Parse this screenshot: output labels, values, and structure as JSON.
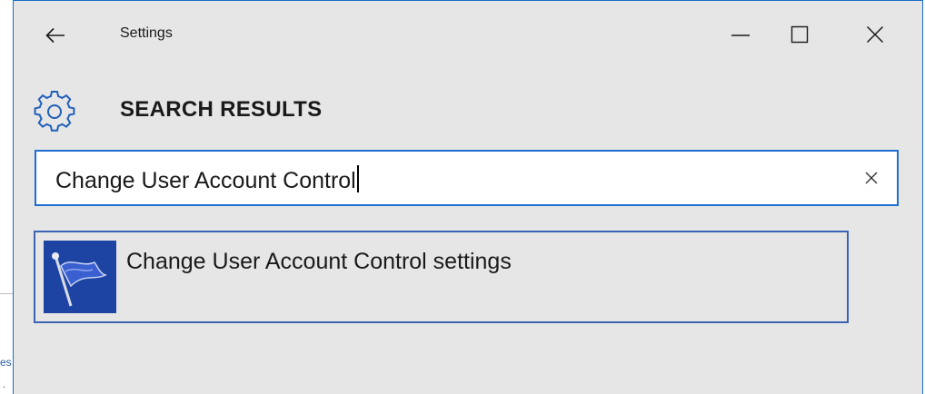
{
  "window": {
    "title": "Settings",
    "controls": {
      "minimize": "minimize-icon",
      "maximize": "maximize-icon",
      "close": "close-icon"
    },
    "back": "back-arrow-icon"
  },
  "header": {
    "title": "SEARCH RESULTS",
    "icon": "gear-icon"
  },
  "search": {
    "value": "Change User Account Control",
    "clear_icon": "clear-icon"
  },
  "results": [
    {
      "label": "Change User Account Control settings",
      "icon": "uac-flag-icon"
    }
  ],
  "background_window": {
    "link_fragment": "es",
    "text_fragment": "."
  },
  "colors": {
    "window_bg": "#e6e6e6",
    "accent": "#1f6fd1",
    "result_border": "#3d64b3",
    "icon_bg": "#1e44a3"
  }
}
